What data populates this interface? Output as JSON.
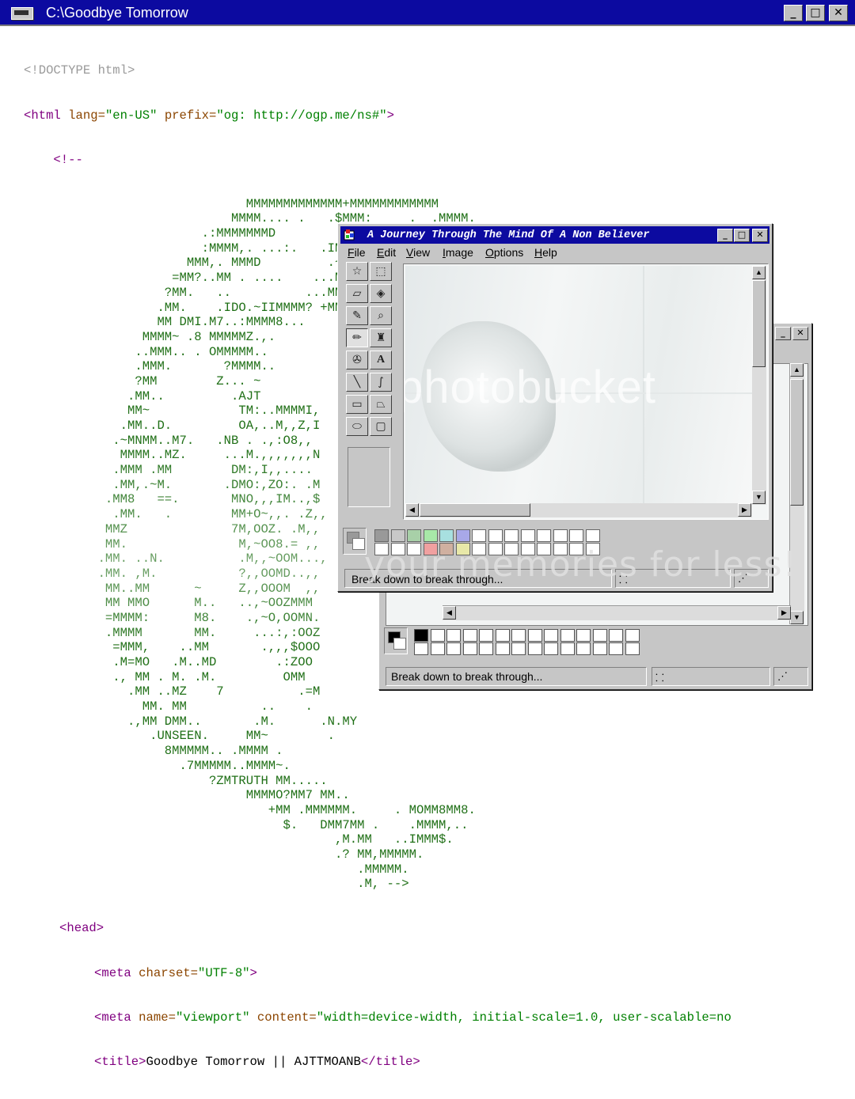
{
  "console": {
    "title": "C:\\Goodbye Tomorrow",
    "buttons": {
      "minimize": "_",
      "maximize": "□",
      "close": "✕"
    },
    "doctype": "<!DOCTYPE html>",
    "html_open": {
      "tag": "<html",
      "attr1": " lang=",
      "val1": "\"en-US\"",
      "attr2": " prefix=",
      "val2": "\"og: http://ogp.me/ns#\"",
      "close": ">"
    },
    "comment_open": "    <!--",
    "ascii_art": [
      "                              MMMMMMMMMMMMM+MMMMMMMMMMMM",
      "                            MMMM.... .   .$MMM:     .  .MMMM.",
      "                        .:MMMMMMMD          ...    .N~.,~MMMMM.",
      "                        :MMMM,. ...:.   .IM       ...      I8NMMMM..",
      "                      MMM,. MMMD         .~M= .     ..      ,DMMMMM:",
      "                    =MM?..MM . ....    ...MM. M.        .=N~  .MMMZ.",
      "                   ?MM.   ..          ...MMM.MMMM.   ~MM=.  ...,8..DMM .",
      "                  .MM.    .IDO.~IIMMMM? +MMM7~  MMM.....ZDO..   ..MM=",
      "                  MM DMI.M7..:MMMM8...    .,.    ...+MMMM~ .=M.=MN.MM",
      "                MMMM~ .8 MMMMMZ.,.                    .=MMMMM.M.. MMMM",
      "               ..MMM.. . OMMMMM..",
      "               .MMM.       ?MMMM..",
      "               ?MM        Z... ~",
      "              .MM..         .AJT",
      "              MM~            TM:..MMMMI,",
      "             .MM..D.         OA,..M,,Z,I",
      "            .~MNMM..M7.   .NB . .,:O8,,",
      "             MMMM..MZ.     ...M.,,,,,,,N",
      "            .MMM .MM        DM:,I,,....",
      "            .MM,.~M.       .DMO:,ZO:. .M",
      "           .MM8   ==.       MNO,,,IM..,$",
      "            .MM.   .        MM+O~,,. .Z,,",
      "           MMZ              7M,OOZ. .M,,",
      "           MM.               M,~OO8.= ,,",
      "          .MM. ..N.          .M,,~OOM...,",
      "          .MM. ,M.           ?,,OOMD..,,",
      "           MM..MM      ~     Z,,OOOM  ,,",
      "           MM MMO      M..   ..,~OOZMMM",
      "           =MMMM:      M8.    .,~O,OOMN.",
      "           .MMMM       MM.     ...:,:OOZ",
      "            =MMM,    ..MM       .,,,$OOO",
      "            .M=MO   .M..MD        .:ZOO",
      "            ., MM . M. .M.         OMM",
      "              .MM ..MZ    7          .=M",
      "                MM. MM          ..    .",
      "              .,MM DMM..       .M.      .N.MY",
      "                 .UNSEEN.     MM~        .",
      "                   8MMMMM.. .MMMM .",
      "                     .7MMMMM..MMMM~.",
      "                         ?ZMTRUTH MM.....",
      "                              MMMMO?MM7 MM..",
      "                                 +MM .MMMMMM.     . MOMM8MM8.",
      "                                   $.   DMM7MM .    .MMMM,..",
      "                                          ,M.MM   ..IMMM$.",
      "                                          .? MM,MMMMM.",
      "                                             .MMMMM.",
      "                                             .M, -->"
    ],
    "head_open": "<head>",
    "meta1": {
      "tag": "<meta",
      "attr": " charset=",
      "val": "\"UTF-8\"",
      "close": ">"
    },
    "meta2": {
      "tag": "<meta",
      "attr1": " name=",
      "val1": "\"viewport\"",
      "attr2": " content=",
      "val2": "\"width=device-width, initial-scale=1.0, user-scalable=no"
    },
    "title_line": {
      "open": "<title>",
      "text": "Goodbye Tomorrow || AJTTMOANB",
      "close": "</title>"
    }
  },
  "paint_front": {
    "title": "A Journey Through The Mind Of A Non Believer",
    "menu": [
      "File",
      "Edit",
      "View",
      "Image",
      "Options",
      "Help"
    ],
    "status": "Break down to break through..."
  },
  "paint_back": {
    "status": "Break down to break through..."
  },
  "watermark": "photobucket",
  "overlay_caption": "your memories for less!",
  "palette_colors_front": [
    "#999999",
    "#c8c8c8",
    "#a8d0a8",
    "#a8e8a8",
    "#a8e0e0",
    "#a8a8e8",
    "#ffffff",
    "#f0a0a0",
    "#d0b0a0",
    "#e8e8a8"
  ],
  "palette_colors_back": [
    "#000000",
    "#ffffff"
  ]
}
